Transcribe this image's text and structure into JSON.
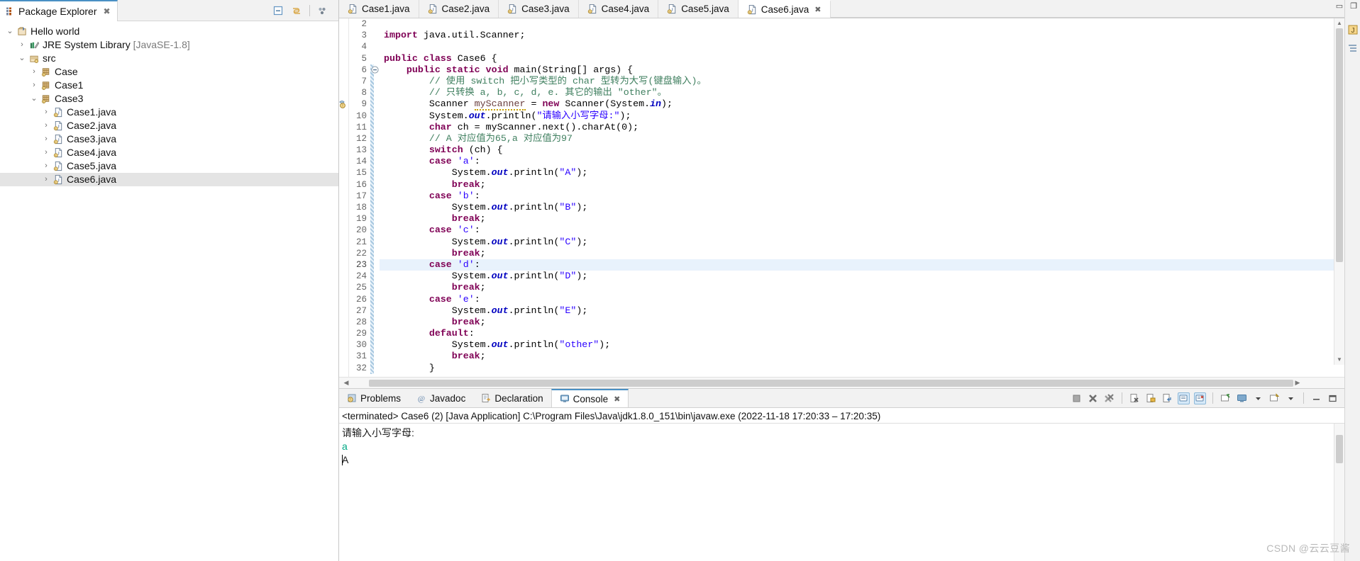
{
  "package_explorer": {
    "tab_label": "Package Explorer",
    "close_icon": "close-icon",
    "toolbar": [
      "collapse-all-icon",
      "link-with-editor-icon",
      "view-menu-icon"
    ],
    "tree": [
      {
        "depth": 0,
        "twist": "v",
        "icon": "java-project-icon",
        "label": "Hello world",
        "suffix": "",
        "selected": false
      },
      {
        "depth": 1,
        "twist": ">",
        "icon": "jre-library-icon",
        "label": "JRE System Library",
        "suffix": " [JavaSE-1.8]",
        "selected": false
      },
      {
        "depth": 1,
        "twist": "v",
        "icon": "source-folder-icon",
        "label": "src",
        "suffix": "",
        "selected": false
      },
      {
        "depth": 2,
        "twist": ">",
        "icon": "package-icon",
        "label": "Case",
        "suffix": "",
        "selected": false
      },
      {
        "depth": 2,
        "twist": ">",
        "icon": "package-icon",
        "label": "Case1",
        "suffix": "",
        "selected": false
      },
      {
        "depth": 2,
        "twist": "v",
        "icon": "package-icon",
        "label": "Case3",
        "suffix": "",
        "selected": false
      },
      {
        "depth": 3,
        "twist": ">",
        "icon": "java-file-icon",
        "label": "Case1.java",
        "suffix": "",
        "selected": false
      },
      {
        "depth": 3,
        "twist": ">",
        "icon": "java-file-icon",
        "label": "Case2.java",
        "suffix": "",
        "selected": false
      },
      {
        "depth": 3,
        "twist": ">",
        "icon": "java-file-icon",
        "label": "Case3.java",
        "suffix": "",
        "selected": false
      },
      {
        "depth": 3,
        "twist": ">",
        "icon": "java-file-icon",
        "label": "Case4.java",
        "suffix": "",
        "selected": false
      },
      {
        "depth": 3,
        "twist": ">",
        "icon": "java-file-icon",
        "label": "Case5.java",
        "suffix": "",
        "selected": false
      },
      {
        "depth": 3,
        "twist": ">",
        "icon": "java-file-icon",
        "label": "Case6.java",
        "suffix": "",
        "selected": true
      }
    ]
  },
  "editor": {
    "tabs": [
      {
        "label": "Case1.java",
        "active": false,
        "closeable": false
      },
      {
        "label": "Case2.java",
        "active": false,
        "closeable": false
      },
      {
        "label": "Case3.java",
        "active": false,
        "closeable": false
      },
      {
        "label": "Case4.java",
        "active": false,
        "closeable": false
      },
      {
        "label": "Case5.java",
        "active": false,
        "closeable": false
      },
      {
        "label": "Case6.java",
        "active": true,
        "closeable": true
      }
    ],
    "close_symbol": "✖",
    "minimize_symbol": "▭",
    "maximize_symbol": "❐",
    "first_line_number": 2,
    "highlighted_line": 23,
    "lines": [
      {
        "n": 2,
        "segments": []
      },
      {
        "n": 3,
        "segments": [
          {
            "t": "import",
            "c": "kw"
          },
          {
            "t": " java.util.Scanner;",
            "c": ""
          }
        ]
      },
      {
        "n": 4,
        "segments": []
      },
      {
        "n": 5,
        "segments": [
          {
            "t": "public class",
            "c": "kw"
          },
          {
            "t": " Case6 {",
            "c": ""
          }
        ]
      },
      {
        "n": 6,
        "fold": true,
        "segments": [
          {
            "t": "    ",
            "c": ""
          },
          {
            "t": "public static void",
            "c": "kw"
          },
          {
            "t": " main(String[] args) {",
            "c": ""
          }
        ]
      },
      {
        "n": 7,
        "segments": [
          {
            "t": "        // 使用 switch 把小写类型的 char 型转为大写(键盘输入)。",
            "c": "cmt"
          }
        ]
      },
      {
        "n": 8,
        "segments": [
          {
            "t": "        // 只转换 a, b, c, d, e. 其它的输出 \"other\"。",
            "c": "cmt"
          }
        ]
      },
      {
        "n": 9,
        "warn": true,
        "segments": [
          {
            "t": "        Scanner ",
            "c": ""
          },
          {
            "t": "myScanner",
            "c": "loc underl"
          },
          {
            "t": " = ",
            "c": ""
          },
          {
            "t": "new",
            "c": "kw"
          },
          {
            "t": " Scanner(System.",
            "c": ""
          },
          {
            "t": "in",
            "c": "fld"
          },
          {
            "t": ");",
            "c": ""
          }
        ]
      },
      {
        "n": 10,
        "segments": [
          {
            "t": "        System.",
            "c": ""
          },
          {
            "t": "out",
            "c": "fld"
          },
          {
            "t": ".println(",
            "c": ""
          },
          {
            "t": "\"请输入小写字母:\"",
            "c": "str"
          },
          {
            "t": ");",
            "c": ""
          }
        ]
      },
      {
        "n": 11,
        "segments": [
          {
            "t": "        ",
            "c": ""
          },
          {
            "t": "char",
            "c": "kw"
          },
          {
            "t": " ch = myScanner.next().charAt(0);",
            "c": ""
          }
        ]
      },
      {
        "n": 12,
        "segments": [
          {
            "t": "        // A 对应值为65,a 对应值为97",
            "c": "cmt"
          }
        ]
      },
      {
        "n": 13,
        "segments": [
          {
            "t": "        ",
            "c": ""
          },
          {
            "t": "switch",
            "c": "kw"
          },
          {
            "t": " (ch) {",
            "c": ""
          }
        ]
      },
      {
        "n": 14,
        "segments": [
          {
            "t": "        ",
            "c": ""
          },
          {
            "t": "case",
            "c": "kw"
          },
          {
            "t": " ",
            "c": ""
          },
          {
            "t": "'a'",
            "c": "str"
          },
          {
            "t": ":",
            "c": ""
          }
        ]
      },
      {
        "n": 15,
        "segments": [
          {
            "t": "            System.",
            "c": ""
          },
          {
            "t": "out",
            "c": "fld"
          },
          {
            "t": ".println(",
            "c": ""
          },
          {
            "t": "\"A\"",
            "c": "str"
          },
          {
            "t": ");",
            "c": ""
          }
        ]
      },
      {
        "n": 16,
        "segments": [
          {
            "t": "            ",
            "c": ""
          },
          {
            "t": "break",
            "c": "kw"
          },
          {
            "t": ";",
            "c": ""
          }
        ]
      },
      {
        "n": 17,
        "segments": [
          {
            "t": "        ",
            "c": ""
          },
          {
            "t": "case",
            "c": "kw"
          },
          {
            "t": " ",
            "c": ""
          },
          {
            "t": "'b'",
            "c": "str"
          },
          {
            "t": ":",
            "c": ""
          }
        ]
      },
      {
        "n": 18,
        "segments": [
          {
            "t": "            System.",
            "c": ""
          },
          {
            "t": "out",
            "c": "fld"
          },
          {
            "t": ".println(",
            "c": ""
          },
          {
            "t": "\"B\"",
            "c": "str"
          },
          {
            "t": ");",
            "c": ""
          }
        ]
      },
      {
        "n": 19,
        "segments": [
          {
            "t": "            ",
            "c": ""
          },
          {
            "t": "break",
            "c": "kw"
          },
          {
            "t": ";",
            "c": ""
          }
        ]
      },
      {
        "n": 20,
        "segments": [
          {
            "t": "        ",
            "c": ""
          },
          {
            "t": "case",
            "c": "kw"
          },
          {
            "t": " ",
            "c": ""
          },
          {
            "t": "'c'",
            "c": "str"
          },
          {
            "t": ":",
            "c": ""
          }
        ]
      },
      {
        "n": 21,
        "segments": [
          {
            "t": "            System.",
            "c": ""
          },
          {
            "t": "out",
            "c": "fld"
          },
          {
            "t": ".println(",
            "c": ""
          },
          {
            "t": "\"C\"",
            "c": "str"
          },
          {
            "t": ");",
            "c": ""
          }
        ]
      },
      {
        "n": 22,
        "segments": [
          {
            "t": "            ",
            "c": ""
          },
          {
            "t": "break",
            "c": "kw"
          },
          {
            "t": ";",
            "c": ""
          }
        ]
      },
      {
        "n": 23,
        "segments": [
          {
            "t": "        ",
            "c": ""
          },
          {
            "t": "case",
            "c": "kw"
          },
          {
            "t": " ",
            "c": ""
          },
          {
            "t": "'d'",
            "c": "str"
          },
          {
            "t": ":",
            "c": ""
          }
        ]
      },
      {
        "n": 24,
        "segments": [
          {
            "t": "            System.",
            "c": ""
          },
          {
            "t": "out",
            "c": "fld"
          },
          {
            "t": ".println(",
            "c": ""
          },
          {
            "t": "\"D\"",
            "c": "str"
          },
          {
            "t": ");",
            "c": ""
          }
        ]
      },
      {
        "n": 25,
        "segments": [
          {
            "t": "            ",
            "c": ""
          },
          {
            "t": "break",
            "c": "kw"
          },
          {
            "t": ";",
            "c": ""
          }
        ]
      },
      {
        "n": 26,
        "segments": [
          {
            "t": "        ",
            "c": ""
          },
          {
            "t": "case",
            "c": "kw"
          },
          {
            "t": " ",
            "c": ""
          },
          {
            "t": "'e'",
            "c": "str"
          },
          {
            "t": ":",
            "c": ""
          }
        ]
      },
      {
        "n": 27,
        "segments": [
          {
            "t": "            System.",
            "c": ""
          },
          {
            "t": "out",
            "c": "fld"
          },
          {
            "t": ".println(",
            "c": ""
          },
          {
            "t": "\"E\"",
            "c": "str"
          },
          {
            "t": ");",
            "c": ""
          }
        ]
      },
      {
        "n": 28,
        "segments": [
          {
            "t": "            ",
            "c": ""
          },
          {
            "t": "break",
            "c": "kw"
          },
          {
            "t": ";",
            "c": ""
          }
        ]
      },
      {
        "n": 29,
        "segments": [
          {
            "t": "        ",
            "c": ""
          },
          {
            "t": "default",
            "c": "kw"
          },
          {
            "t": ":",
            "c": ""
          }
        ]
      },
      {
        "n": 30,
        "segments": [
          {
            "t": "            System.",
            "c": ""
          },
          {
            "t": "out",
            "c": "fld"
          },
          {
            "t": ".println(",
            "c": ""
          },
          {
            "t": "\"other\"",
            "c": "str"
          },
          {
            "t": ");",
            "c": ""
          }
        ]
      },
      {
        "n": 31,
        "segments": [
          {
            "t": "            ",
            "c": ""
          },
          {
            "t": "break",
            "c": "kw"
          },
          {
            "t": ";",
            "c": ""
          }
        ]
      },
      {
        "n": 32,
        "segments": [
          {
            "t": "        }",
            "c": ""
          }
        ]
      }
    ]
  },
  "bottom_panel": {
    "tabs": [
      {
        "label": "Problems",
        "icon": "problems-icon",
        "active": false
      },
      {
        "label": "Javadoc",
        "icon": "javadoc-icon",
        "active": false
      },
      {
        "label": "Declaration",
        "icon": "declaration-icon",
        "active": false
      },
      {
        "label": "Console",
        "icon": "console-icon",
        "active": true
      }
    ],
    "close_symbol": "✖",
    "toolbar": [
      "terminate-icon",
      "remove-launch-icon",
      "remove-all-terminated-icon",
      "clear-console-icon",
      "scroll-lock-icon",
      "word-wrap-icon",
      "show-console-on-output-icon",
      "show-console-on-error-icon",
      "pin-console-icon",
      "display-selected-console-icon",
      "open-console-dropdown-icon",
      "minimize-icon",
      "maximize-icon"
    ],
    "terminated_line": "<terminated> Case6 (2) [Java Application] C:\\Program Files\\Java\\jdk1.8.0_151\\bin\\javaw.exe  (2022-11-18 17:20:33 – 17:20:35)",
    "output": [
      {
        "text": "请输入小写字母:",
        "kind": "stdout"
      },
      {
        "text": "a",
        "kind": "stdin"
      },
      {
        "text": "A",
        "kind": "stdout",
        "caret": true
      }
    ]
  },
  "watermark": "CSDN @云云豆酱"
}
